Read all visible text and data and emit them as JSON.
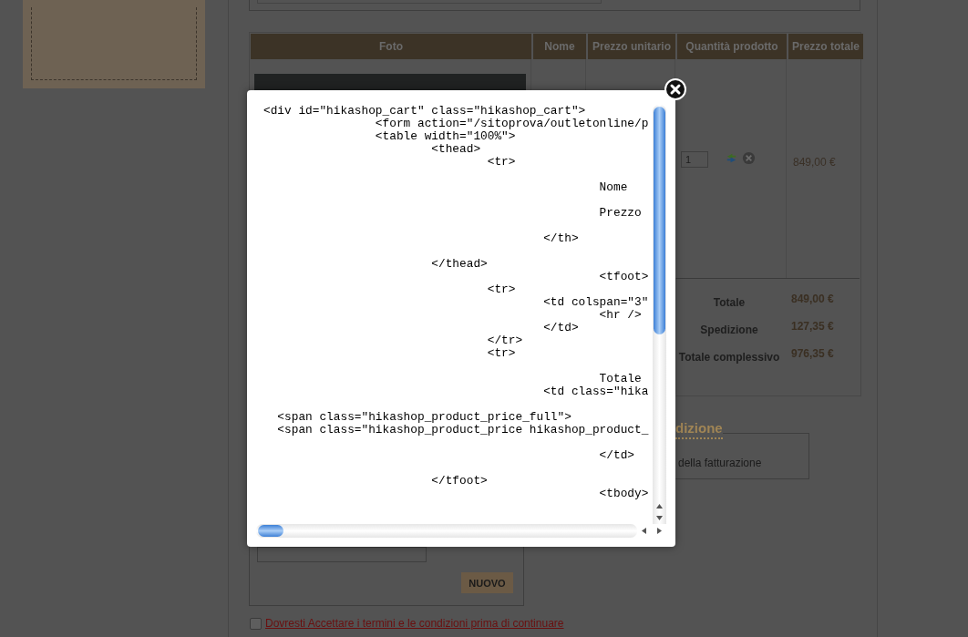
{
  "cart": {
    "columns": [
      "Foto",
      "Nome",
      "Prezzo unitario",
      "Quantità prodotto",
      "Prezzo totale"
    ],
    "rows": [
      {
        "quantity": "1",
        "total": "849,00 €"
      }
    ],
    "totals": [
      {
        "label": "Totale",
        "value": "849,00 €"
      },
      {
        "label": "Spedizione",
        "value": "127,35 €"
      },
      {
        "label": "Totale complessivo",
        "value": "976,35 €"
      }
    ]
  },
  "address_section": {
    "legend": "dizione",
    "text": "della fatturazione"
  },
  "new_button": "NUOVO",
  "terms": {
    "checked": false,
    "link": "Dovresti Accettare i termini e le condizioni prima di continuare"
  },
  "code_popup": {
    "blocks": [
      [
        "<div id=\"hikashop_cart\" class=\"hikashop_cart\">",
        "                <form action=\"/sitoprova/outletonline/p",
        "                <table width=\"100%\">",
        "                        <thead>",
        "                                <tr>"
      ],
      [
        "                                                Nome"
      ],
      [
        "                                                Prezzo"
      ],
      [
        "                                        </th>"
      ],
      [
        "                        </thead>",
        "                                                <tfoot>",
        "                                <tr>",
        "                                        <td colspan=\"3\"",
        "                                                <hr />",
        "                                        </td>",
        "                                </tr>",
        "                                <tr>"
      ],
      [
        "                                                Totale",
        "                                        <td class=\"hika"
      ],
      [
        "  <span class=\"hikashop_product_price_full\">",
        "  <span class=\"hikashop_product_price hikashop_product_"
      ],
      [
        "                                                </td>"
      ],
      [
        "                        </tfoot>",
        "                                                <tbody>"
      ]
    ]
  }
}
